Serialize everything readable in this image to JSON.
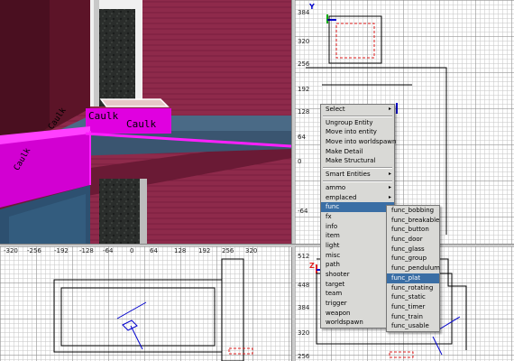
{
  "top_right_view": {
    "axis_label": "Y",
    "ruler_labels": [
      "384",
      "320",
      "256",
      "192",
      "128",
      "64",
      "0",
      "-64"
    ]
  },
  "bottom_left_view": {
    "ruler_labels": [
      "-320",
      "-256",
      "-192",
      "-128",
      "-64",
      "0",
      "64",
      "128",
      "192",
      "256",
      "320"
    ]
  },
  "bottom_right_view": {
    "axis_label": "Z",
    "ruler_labels": [
      "512",
      "448",
      "384",
      "320",
      "256"
    ]
  },
  "viewport_3d": {
    "textures": [
      "Caulk",
      "Caulk",
      "Caulk",
      "Caulk"
    ]
  },
  "context_menu": {
    "items": [
      {
        "label": "Select",
        "submenu": true
      },
      {
        "separator": true
      },
      {
        "label": "Ungroup Entity"
      },
      {
        "label": "Move into entity"
      },
      {
        "label": "Move into worldspawn"
      },
      {
        "label": "Make Detail"
      },
      {
        "label": "Make Structural"
      },
      {
        "separator": true
      },
      {
        "label": "Smart Entities",
        "submenu": true
      },
      {
        "separator": true
      },
      {
        "label": "ammo",
        "submenu": true
      },
      {
        "label": "emplaced",
        "submenu": true
      },
      {
        "label": "func",
        "submenu": true,
        "selected": true
      },
      {
        "label": "fx",
        "submenu": true
      },
      {
        "label": "info",
        "submenu": true
      },
      {
        "label": "item",
        "submenu": true
      },
      {
        "label": "light",
        "submenu": true
      },
      {
        "label": "misc",
        "submenu": true
      },
      {
        "label": "path",
        "submenu": true
      },
      {
        "label": "shooter",
        "submenu": true
      },
      {
        "label": "target",
        "submenu": true
      },
      {
        "label": "team",
        "submenu": true
      },
      {
        "label": "trigger",
        "submenu": true
      },
      {
        "label": "weapon",
        "submenu": true
      },
      {
        "label": "worldspawn"
      }
    ]
  },
  "func_submenu": {
    "items": [
      {
        "label": "func_bobbing"
      },
      {
        "label": "func_breakable"
      },
      {
        "label": "func_button"
      },
      {
        "label": "func_door"
      },
      {
        "label": "func_glass"
      },
      {
        "label": "func_group"
      },
      {
        "label": "func_pendulum"
      },
      {
        "label": "func_plat",
        "selected": true
      },
      {
        "label": "func_rotating"
      },
      {
        "label": "func_static"
      },
      {
        "label": "func_timer"
      },
      {
        "label": "func_train"
      },
      {
        "label": "func_usable"
      }
    ]
  },
  "colors": {
    "selection": "#3a6ea5",
    "wall": "#8a2445",
    "caulk": "#e000e0",
    "brush_selected": "#e02020"
  }
}
